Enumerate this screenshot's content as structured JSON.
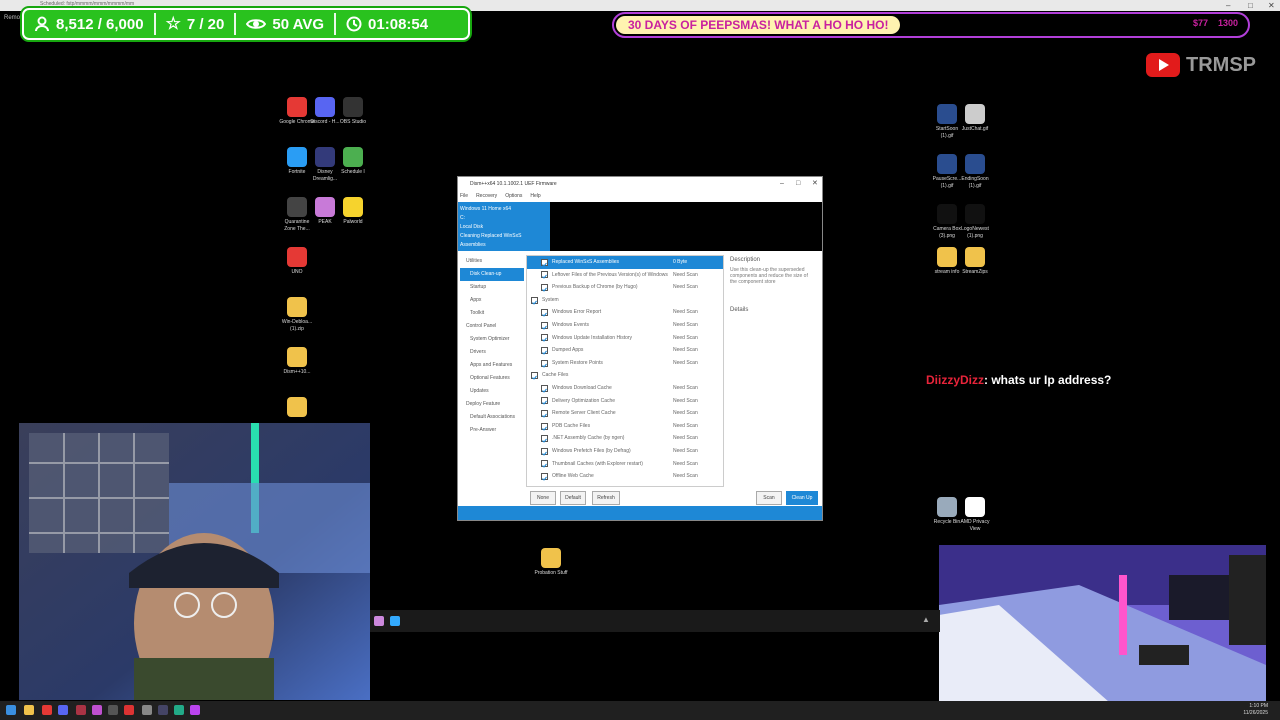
{
  "topbar": {
    "url_text": "Scheduled: fstp/mmmm/mmm/mmmm/mm",
    "remote_label": "RemoteD"
  },
  "stats": {
    "followers": "8,512 / 6,000",
    "rating": "7 / 20",
    "views": "50 AVG",
    "timer": "01:08:54"
  },
  "ticker": {
    "text": "30 DAYS OF PEEPSMAS! WHAT A HO HO HO!",
    "right_a": "$77",
    "right_b": "1300"
  },
  "brand": {
    "name": "TRMSP"
  },
  "desktop_icons_left": [
    {
      "label": "Google Chrome",
      "color": "#e53935"
    },
    {
      "label": "Discord - H...",
      "color": "#5865f2"
    },
    {
      "label": "OBS Studio",
      "color": "#333333"
    },
    {
      "label": "Fortnite",
      "color": "#2a9df4"
    },
    {
      "label": "Disney Dreamlig...",
      "color": "#333a7a"
    },
    {
      "label": "Schedule I",
      "color": "#4caf50"
    },
    {
      "label": "Quarantine Zone The...",
      "color": "#444444"
    },
    {
      "label": "PEAK",
      "color": "#c87ad8"
    },
    {
      "label": "Palworld",
      "color": "#f6d32d"
    },
    {
      "label": "UNO",
      "color": "#e53935"
    },
    {
      "label": "Win-Debloa... (1).zip",
      "color": "#f0c24b"
    },
    {
      "label": "Dism++10...",
      "color": "#f0c24b"
    },
    {
      "label": "",
      "color": "#f0c24b"
    }
  ],
  "desktop_icons_right": [
    {
      "label": "StartSoon (1).gif",
      "color": "#2a4d8f"
    },
    {
      "label": "JustChat.gif",
      "color": "#cccccc"
    },
    {
      "label": "PauseScre... (1).gif",
      "color": "#2a4d8f"
    },
    {
      "label": "EndingSoon (1).gif",
      "color": "#2a4d8f"
    },
    {
      "label": "Camera Box (3).png",
      "color": "#111111"
    },
    {
      "label": "LogoNewest (1).png",
      "color": "#111111"
    },
    {
      "label": "stream info",
      "color": "#f0c24b"
    },
    {
      "label": "StreamZips",
      "color": "#f0c24b"
    },
    {
      "label": "Recycle Bin",
      "color": "#9ab"
    },
    {
      "label": "AMD Privacy View",
      "color": "#ffffff"
    }
  ],
  "desktop_icon_bottom": {
    "label": "Probation Stuff",
    "color": "#f0c24b"
  },
  "app": {
    "title": "Dism++x64 10.1.1002.1 UEF Firmware",
    "menu": [
      "File",
      "Recovery",
      "Options",
      "Help"
    ],
    "header_lines": [
      "Windows 11 Home x64",
      "C:",
      "Local Disk",
      "Cleaning Replaced WinSxS Assemblies"
    ],
    "sidebar": [
      "Utilities",
      "Disk Clean-up",
      "Startup",
      "Appx",
      "Toolkit",
      "Control Panel",
      "System Optimizer",
      "Drivers",
      "Apps and Features",
      "Optional Features",
      "Updates",
      "Deploy Feature",
      "Default Associations",
      "Pre-Answer"
    ],
    "sidebar_selected": 1,
    "rows": [
      {
        "name": "Replaced WinSxS Assemblies",
        "value": "0 Byte",
        "sel": true
      },
      {
        "name": "Leftover Files of the Previous Version(s) of Windows",
        "value": "Need Scan"
      },
      {
        "name": "Previous Backup of Chrome (by Hugo)",
        "value": "Need Scan"
      },
      {
        "name": "System",
        "value": ""
      },
      {
        "name": "Windows Error Report",
        "value": "Need Scan"
      },
      {
        "name": "Windows Events",
        "value": "Need Scan"
      },
      {
        "name": "Windows Update Installation History",
        "value": "Need Scan"
      },
      {
        "name": "Dumped Apps",
        "value": "Need Scan"
      },
      {
        "name": "System Restore Points",
        "value": "Need Scan"
      },
      {
        "name": "Cache Files",
        "value": ""
      },
      {
        "name": "Windows Download Cache",
        "value": "Need Scan"
      },
      {
        "name": "Delivery Optimization Cache",
        "value": "Need Scan"
      },
      {
        "name": "Remote Server Client Cache",
        "value": "Need Scan"
      },
      {
        "name": "PDB Cache Files",
        "value": "Need Scan"
      },
      {
        "name": ".NET Assembly Cache (by ngen)",
        "value": "Need Scan"
      },
      {
        "name": "Windows Prefetch Files (by Defrag)",
        "value": "Need Scan"
      },
      {
        "name": "Thumbnail Caches (with Explorer restart)",
        "value": "Need Scan"
      },
      {
        "name": "Offline Web Cache",
        "value": "Need Scan"
      }
    ],
    "description_title": "Description",
    "description_text": "Use this clean-up the superseded components and reduce the size of the component store",
    "details_label": "Details",
    "buttons": {
      "none": "None",
      "default": "Default",
      "refresh": "Refresh",
      "scan": "Scan",
      "clean": "Clean Up"
    }
  },
  "chat": {
    "user": "DiizzyDizz",
    "message": ": whats ur Ip address?"
  },
  "taskbar": {
    "time": "1:10 PM",
    "date": "11/26/2025"
  }
}
